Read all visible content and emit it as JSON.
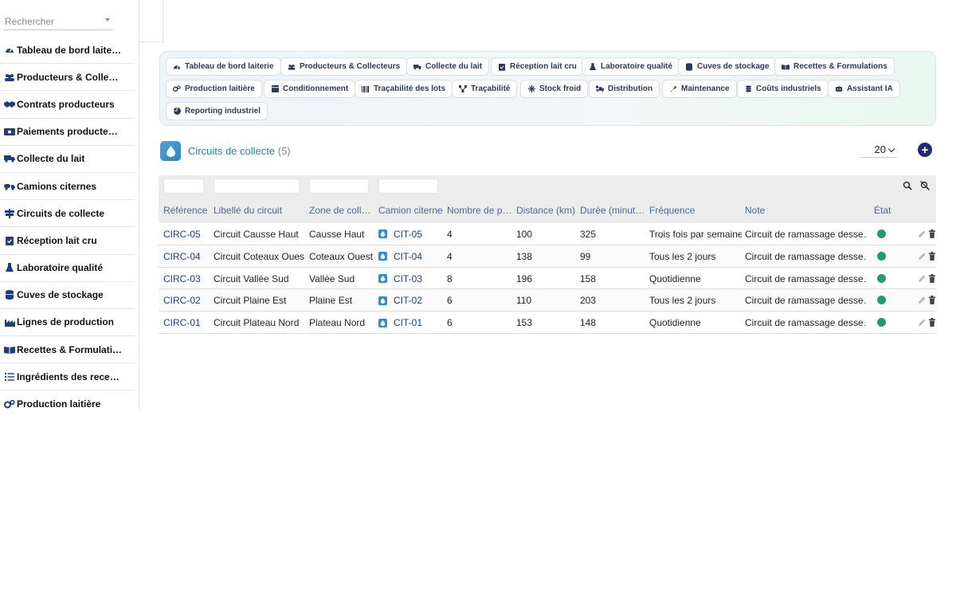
{
  "search": {
    "placeholder": "Rechercher"
  },
  "sidebar": {
    "items": [
      {
        "label": "Tableau de bord laite…",
        "icon": "gauge-icon"
      },
      {
        "label": "Producteurs & Colle…",
        "icon": "users-icon"
      },
      {
        "label": "Contrats producteurs",
        "icon": "handshake-icon"
      },
      {
        "label": "Paiements producte…",
        "icon": "money-icon"
      },
      {
        "label": "Collecte du lait",
        "icon": "truck-icon"
      },
      {
        "label": "Camions citernes",
        "icon": "tanker-icon"
      },
      {
        "label": "Circuits de collecte",
        "icon": "signs-icon"
      },
      {
        "label": "Réception lait cru",
        "icon": "clipboard-check-icon"
      },
      {
        "label": "Laboratoire qualité",
        "icon": "flask-icon"
      },
      {
        "label": "Cuves de stockage",
        "icon": "database-icon"
      },
      {
        "label": "Lignes de production",
        "icon": "industry-icon"
      },
      {
        "label": "Recettes & Formulati…",
        "icon": "book-icon"
      },
      {
        "label": "Ingrédients des rece…",
        "icon": "list-icon"
      },
      {
        "label": "Production laitière",
        "icon": "gears-icon"
      }
    ]
  },
  "menu": {
    "buttons": [
      {
        "label": "Tableau de bord laiterie",
        "icon": "gauge-icon"
      },
      {
        "label": "Producteurs & Collecteurs",
        "icon": "users-icon"
      },
      {
        "label": "Collecte du lait",
        "icon": "truck-icon"
      },
      {
        "label": "Réception lait cru",
        "icon": "clipboard-check-icon"
      },
      {
        "label": "Laboratoire qualité",
        "icon": "flask-icon"
      },
      {
        "label": "Cuves de stockage",
        "icon": "database-icon"
      },
      {
        "label": "Recettes & Formulations",
        "icon": "book-icon"
      },
      {
        "label": "Production laitière",
        "icon": "gears-icon"
      },
      {
        "label": "Conditionnement",
        "icon": "box-icon"
      },
      {
        "label": "Traçabilité des lots",
        "icon": "barcode-icon"
      },
      {
        "label": "Traçabilité",
        "icon": "diagram-icon"
      },
      {
        "label": "Stock froid",
        "icon": "snowflake-icon"
      },
      {
        "label": "Distribution",
        "icon": "truck-loading-icon"
      },
      {
        "label": "Maintenance",
        "icon": "wrench-icon"
      },
      {
        "label": "Coûts industriels",
        "icon": "coins-icon"
      },
      {
        "label": "Assistant IA",
        "icon": "robot-icon"
      },
      {
        "label": "Reporting industriel",
        "icon": "pie-chart-icon"
      }
    ]
  },
  "page": {
    "title": "Circuits de collecte",
    "count": "(5)",
    "page_size": "20",
    "add_label": "+"
  },
  "table": {
    "columns": [
      "Référence",
      "Libellé du circuit",
      "Zone de coll…",
      "Camion citerne",
      "Nombre de p…",
      "Distance (km)",
      "Durée (minut…",
      "Fréquence",
      "Note",
      "État"
    ],
    "rows": [
      {
        "ref": "CIRC-05",
        "label": "Circuit Causse Haut",
        "zone": "Causse Haut",
        "truck": "CIT-05",
        "points": "4",
        "distance": "100",
        "duration": "325",
        "frequency": "Trois fois par semaine",
        "note": "Circuit de ramassage desse…",
        "state_color": "#1e9e6a"
      },
      {
        "ref": "CIRC-04",
        "label": "Circuit Coteaux Ouest",
        "zone": "Coteaux Ouest",
        "truck": "CIT-04",
        "points": "4",
        "distance": "138",
        "duration": "99",
        "frequency": "Tous les 2 jours",
        "note": "Circuit de ramassage desse…",
        "state_color": "#1e9e6a"
      },
      {
        "ref": "CIRC-03",
        "label": "Circuit Vallée Sud",
        "zone": "Vallée Sud",
        "truck": "CIT-03",
        "points": "8",
        "distance": "196",
        "duration": "158",
        "frequency": "Quotidienne",
        "note": "Circuit de ramassage desse…",
        "state_color": "#1e9e6a"
      },
      {
        "ref": "CIRC-02",
        "label": "Circuit Plaine Est",
        "zone": "Plaine Est",
        "truck": "CIT-02",
        "points": "6",
        "distance": "110",
        "duration": "203",
        "frequency": "Tous les 2 jours",
        "note": "Circuit de ramassage desse…",
        "state_color": "#1e9e6a"
      },
      {
        "ref": "CIRC-01",
        "label": "Circuit Plateau Nord",
        "zone": "Plateau Nord",
        "truck": "CIT-01",
        "points": "6",
        "distance": "153",
        "duration": "148",
        "frequency": "Quotidienne",
        "note": "Circuit de ramassage desse…",
        "state_color": "#1e9e6a"
      }
    ]
  },
  "colors": {
    "accent": "#1a8a9a",
    "link": "#1f3f7a",
    "header_text": "#4a6a9a",
    "add_button": "#1e2d6b",
    "status_ok": "#1e9e6a"
  }
}
